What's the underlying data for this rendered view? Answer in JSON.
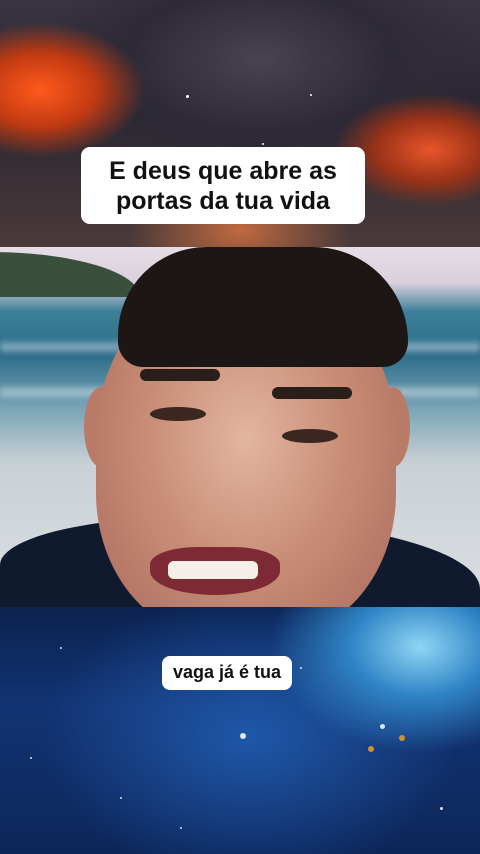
{
  "captions": {
    "top_line1": "E deus que abre as",
    "top_line2": "portas da tua vida",
    "bottom": "vaga já é tua"
  },
  "colors": {
    "caption_background": "#ffffff",
    "caption_text": "#111111",
    "top_sky": "#3a3440",
    "bottom_sky": "#123372"
  }
}
